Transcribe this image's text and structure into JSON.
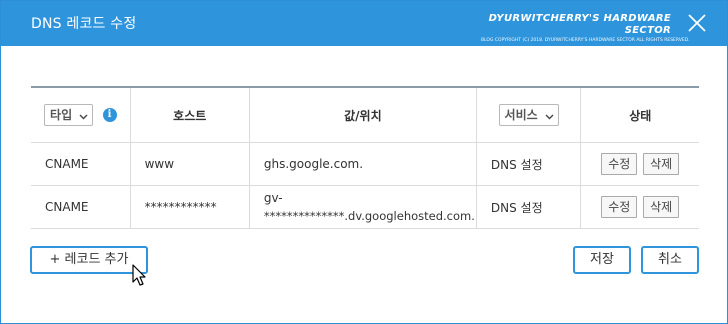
{
  "dialog": {
    "title": "DNS 레코드 수정",
    "brand_name": "DYURWITCHERRY'S HARDWARE SECTOR",
    "brand_copy": "BLOG COPYRIGHT (C) 2018. DYURWITCHERRY'S HARDWARE SECTOR ALL RIGHTS RESERVED."
  },
  "table": {
    "headers": {
      "type_select": "타입",
      "info": "i",
      "host": "호스트",
      "value": "값/위치",
      "service_select": "서비스",
      "status": "상태"
    },
    "rows": [
      {
        "type": "CNAME",
        "host": "www",
        "value_line1": "ghs.google.com.",
        "value_line2": "",
        "service": "DNS 설정",
        "edit": "수정",
        "delete": "삭제"
      },
      {
        "type": "CNAME",
        "host": "************",
        "value_line1": "gv-",
        "value_line2": "**************.dv.googlehosted.com.",
        "service": "DNS 설정",
        "edit": "수정",
        "delete": "삭제"
      }
    ]
  },
  "footer": {
    "add_record": "+ 레코드 추가",
    "save": "저장",
    "cancel": "취소"
  },
  "colors": {
    "titlebar": "#2e94dc",
    "accent": "#2e94dc"
  }
}
